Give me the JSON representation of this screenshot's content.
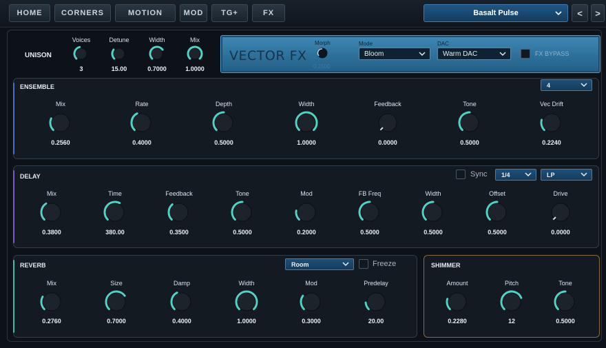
{
  "nav": {
    "tabs": [
      "HOME",
      "CORNERS",
      "MOTION",
      "MOD",
      "TG+",
      "FX"
    ],
    "preset": "Basalt Pulse",
    "prev": "<",
    "next": ">"
  },
  "unison": {
    "title": "UNISON",
    "params": [
      {
        "label": "Voices",
        "value": "3",
        "level": 0.45
      },
      {
        "label": "Detune",
        "value": "15.00",
        "level": 0.3
      },
      {
        "label": "Width",
        "value": "0.7000",
        "level": 0.7
      },
      {
        "label": "Mix",
        "value": "1.0000",
        "level": 1.0
      }
    ]
  },
  "vector_fx": {
    "title": "VECTOR FX",
    "morph_label": "Morph",
    "morph_value": "0.2500",
    "mode_label": "Mode",
    "mode_value": "Bloom",
    "dac_label": "DAC",
    "dac_value": "Warm DAC",
    "bypass_label": "FX BYPASS"
  },
  "ensemble": {
    "title": "ENSEMBLE",
    "dropdown": "4",
    "params": [
      {
        "label": "Mix",
        "value": "0.2560",
        "level": 0.256
      },
      {
        "label": "Rate",
        "value": "0.4000",
        "level": 0.4
      },
      {
        "label": "Depth",
        "value": "0.5000",
        "level": 0.5
      },
      {
        "label": "Width",
        "value": "1.0000",
        "level": 1.0
      },
      {
        "label": "Feedback",
        "value": "0.0000",
        "level": 0.0
      },
      {
        "label": "Tone",
        "value": "0.5000",
        "level": 0.5
      },
      {
        "label": "Vec Drift",
        "value": "0.2240",
        "level": 0.224
      }
    ]
  },
  "delay": {
    "title": "DELAY",
    "sync_label": "Sync",
    "division": "1/4",
    "filter": "LP",
    "params": [
      {
        "label": "Mix",
        "value": "0.3800",
        "level": 0.38
      },
      {
        "label": "Time",
        "value": "380.00",
        "level": 0.6
      },
      {
        "label": "Feedback",
        "value": "0.3500",
        "level": 0.35
      },
      {
        "label": "Tone",
        "value": "0.5000",
        "level": 0.5
      },
      {
        "label": "Mod",
        "value": "0.2000",
        "level": 0.2
      },
      {
        "label": "FB Freq",
        "value": "0.5000",
        "level": 0.5
      },
      {
        "label": "Width",
        "value": "0.5000",
        "level": 0.5
      },
      {
        "label": "Offset",
        "value": "0.5000",
        "level": 0.5
      },
      {
        "label": "Drive",
        "value": "0.0000",
        "level": 0.0
      }
    ]
  },
  "reverb": {
    "title": "REVERB",
    "type": "Room",
    "freeze_label": "Freeze",
    "params": [
      {
        "label": "Mix",
        "value": "0.2760",
        "level": 0.276
      },
      {
        "label": "Size",
        "value": "0.7000",
        "level": 0.7
      },
      {
        "label": "Damp",
        "value": "0.4000",
        "level": 0.4
      },
      {
        "label": "Width",
        "value": "1.0000",
        "level": 1.0
      },
      {
        "label": "Mod",
        "value": "0.3000",
        "level": 0.3
      },
      {
        "label": "Predelay",
        "value": "20.00",
        "level": 0.15
      }
    ]
  },
  "shimmer": {
    "title": "SHIMMER",
    "params": [
      {
        "label": "Amount",
        "value": "0.2280",
        "level": 0.228
      },
      {
        "label": "Pitch",
        "value": "12",
        "level": 0.75
      },
      {
        "label": "Tone",
        "value": "0.5000",
        "level": 0.5
      }
    ]
  },
  "colors": {
    "accent": "#4fd3c4",
    "ensemble_accent": "#4a6fc9",
    "delay_accent": "#7a5cc9",
    "reverb_accent": "#3fbfa5",
    "shimmer_border": "#8a6a3a"
  }
}
